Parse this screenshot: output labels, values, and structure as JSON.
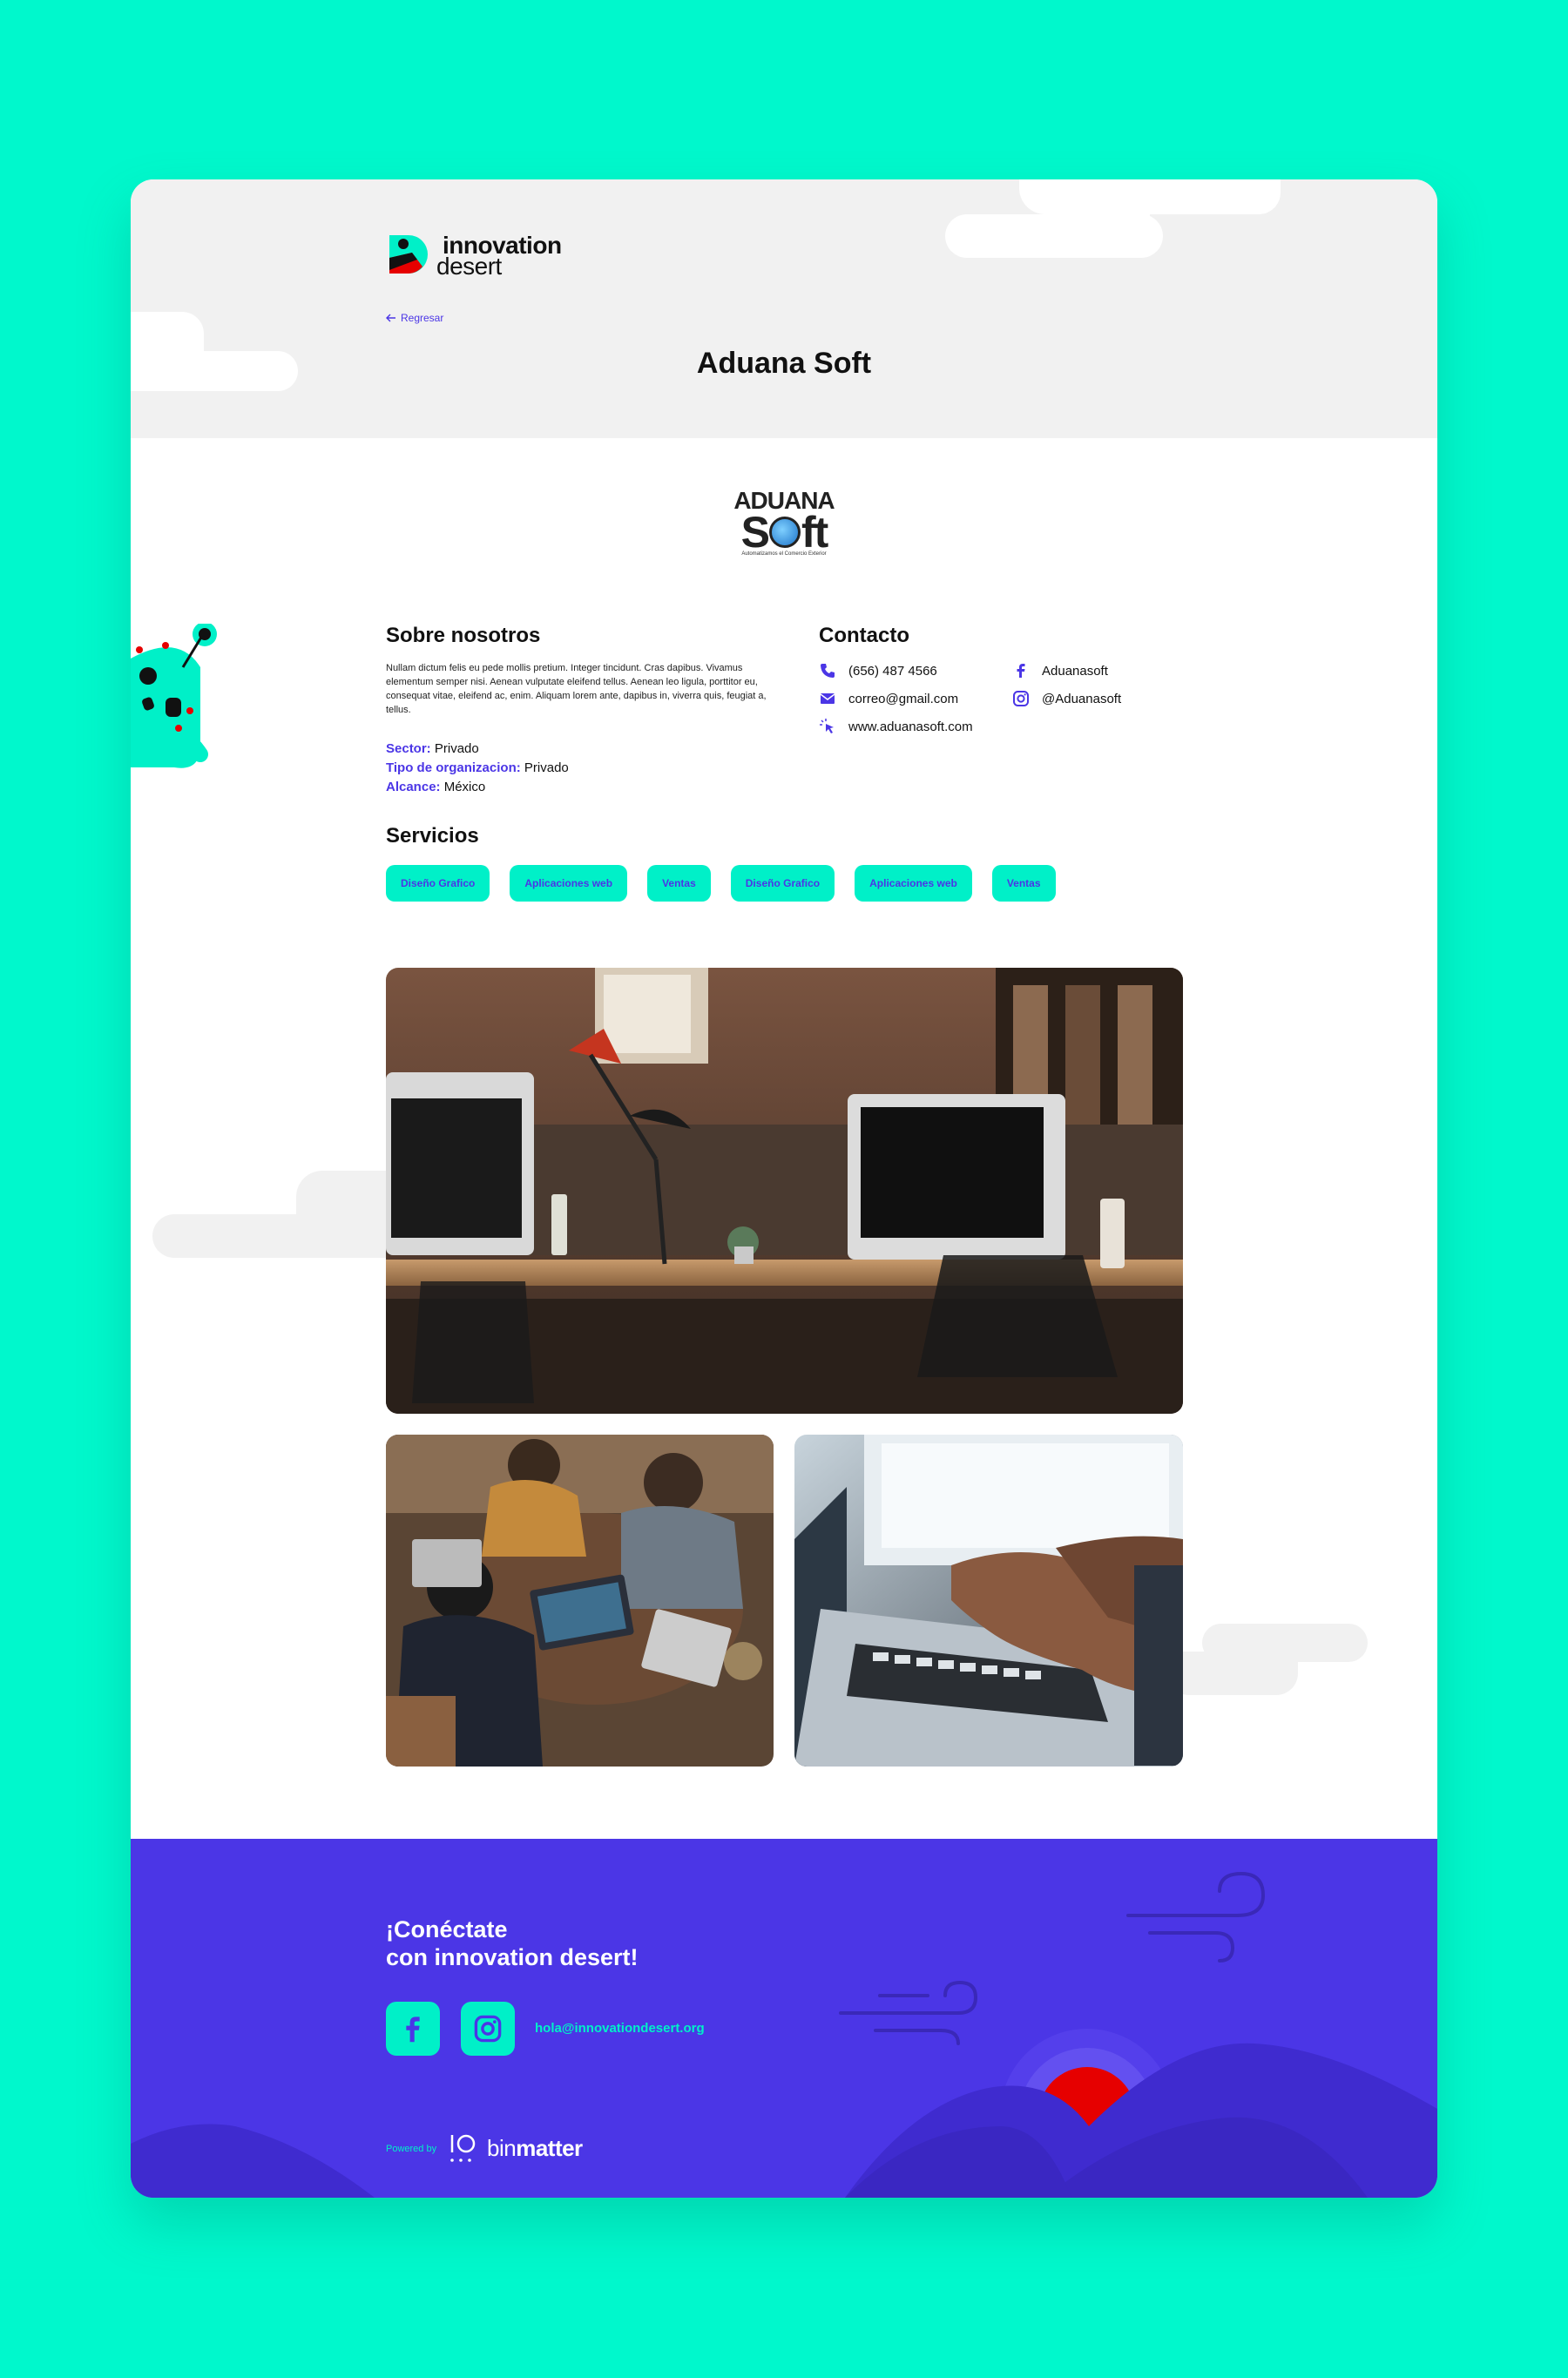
{
  "header": {
    "logo_line1": "innovation",
    "logo_line2": "desert",
    "back_label": "Regresar",
    "title": "Aduana Soft"
  },
  "company_logo": {
    "line1": "ADUANA",
    "line2_a": "S",
    "line2_b": "ft",
    "tagline": "Automatizamos el Comercio Exterior"
  },
  "about": {
    "heading": "Sobre nosotros",
    "text": "Nullam dictum felis eu pede mollis pretium. Integer tincidunt. Cras dapibus. Vivamus elementum semper nisi. Aenean vulputate eleifend tellus. Aenean leo ligula, porttitor eu, consequat vitae, eleifend ac, enim. Aliquam lorem ante, dapibus in, viverra quis, feugiat a, tellus.",
    "sector_label": "Sector:",
    "sector_value": "Privado",
    "org_label": "Tipo de organizacion:",
    "org_value": "Privado",
    "scope_label": "Alcance:",
    "scope_value": "México"
  },
  "contact": {
    "heading": "Contacto",
    "phone": "(656) 487 4566",
    "email": "correo@gmail.com",
    "website": "www.aduanasoft.com",
    "facebook": "Aduanasoft",
    "instagram": "@Aduanasoft"
  },
  "services": {
    "heading": "Servicios",
    "tags": [
      "Diseño Grafico",
      "Aplicaciones web",
      "Ventas",
      "Diseño Grafico",
      "Aplicaciones web",
      "Ventas"
    ]
  },
  "footer": {
    "title_line1": "¡Conéctate",
    "title_line2": "con innovation desert!",
    "email": "hola@innovationdesert.org",
    "powered_by": "Powered by",
    "brand_a": "bin",
    "brand_b": "matter"
  },
  "colors": {
    "background": "#00f8cc",
    "accent": "#4b36e6",
    "tag_bg": "#00f0c8",
    "header_bg": "#f1f1f1",
    "red": "#e60000"
  },
  "icons": [
    "arrow-left-icon",
    "phone-icon",
    "mail-icon",
    "cursor-icon",
    "facebook-icon",
    "instagram-icon"
  ]
}
